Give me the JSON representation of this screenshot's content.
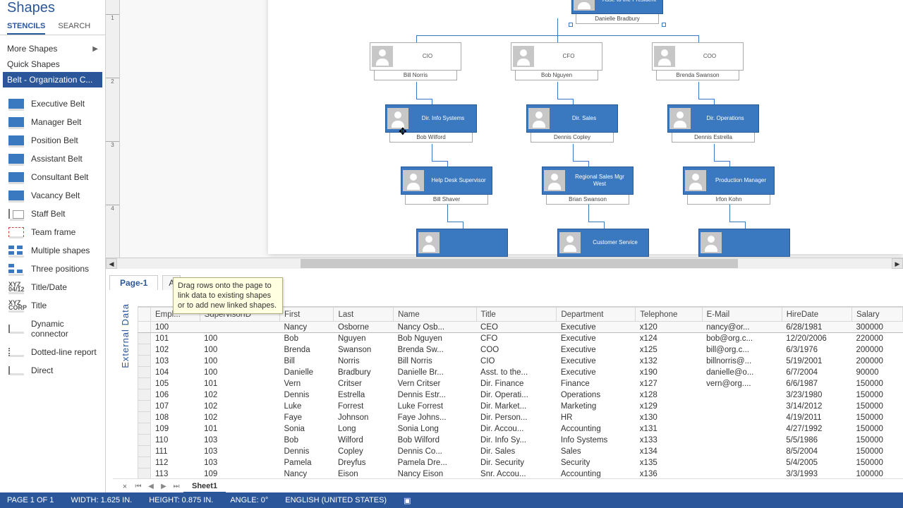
{
  "shapes": {
    "title": "Shapes",
    "tabs": {
      "stencils": "STENCILS",
      "search": "SEARCH"
    },
    "links": {
      "more": "More Shapes",
      "quick": "Quick Shapes",
      "belt": "Belt - Organization C..."
    },
    "stencils": [
      {
        "icon": "belt",
        "label": "Executive Belt"
      },
      {
        "icon": "belt",
        "label": "Manager Belt"
      },
      {
        "icon": "belt",
        "label": "Position Belt"
      },
      {
        "icon": "belt",
        "label": "Assistant Belt"
      },
      {
        "icon": "belt",
        "label": "Consultant Belt"
      },
      {
        "icon": "belt",
        "label": "Vacancy Belt"
      },
      {
        "icon": "staff",
        "label": "Staff Belt"
      },
      {
        "icon": "team",
        "label": "Team frame"
      },
      {
        "icon": "mult",
        "label": "Multiple shapes"
      },
      {
        "icon": "three",
        "label": "Three positions"
      },
      {
        "icon": "text",
        "text": "XYZ\n04/12",
        "label": "Title/Date"
      },
      {
        "icon": "text",
        "text": "XYZ\nCORP",
        "label": "Title"
      },
      {
        "icon": "conn",
        "label": "Dynamic connector"
      },
      {
        "icon": "dot",
        "label": "Dotted-line report"
      },
      {
        "icon": "conn",
        "label": "Direct"
      }
    ]
  },
  "pages": {
    "page1": "Page-1",
    "all": "A"
  },
  "tooltip": "Drag rows onto the page to link data to existing shapes or to add new linked shapes.",
  "external_label": "External Data",
  "org": {
    "asst": {
      "role": "Asst. to the President",
      "name": "Danielle Bradbury"
    },
    "cio": {
      "role": "CIO",
      "name": "Bill Norris"
    },
    "cfo": {
      "role": "CFO",
      "name": "Bob Nguyen"
    },
    "coo": {
      "role": "COO",
      "name": "Brenda Swanson"
    },
    "dinfo": {
      "role": "Dir. Info Systems",
      "name": "Bob Wilford"
    },
    "dsales": {
      "role": "Dir. Sales",
      "name": "Dennis Copley"
    },
    "dops": {
      "role": "Dir. Operations",
      "name": "Dennis Estrella"
    },
    "help": {
      "role": "Help Desk Supervisor",
      "name": "Bill Shaver"
    },
    "rsw": {
      "role": "Regional Sales Mgr West",
      "name": "Brian Swanson"
    },
    "prod": {
      "role": "Production Manager",
      "name": "Irfon Kohn"
    },
    "cust": {
      "role": "Customer Service",
      "name": ""
    }
  },
  "table": {
    "columns": [
      "Empl...",
      "SupervisorID",
      "First",
      "Last",
      "Name",
      "Title",
      "Department",
      "Telephone",
      "E-Mail",
      "HireDate",
      "Salary"
    ],
    "rows": [
      [
        "100",
        "",
        "Nancy",
        "Osborne",
        "Nancy Osb...",
        "CEO",
        "Executive",
        "x120",
        "nancy@or...",
        "6/28/1981",
        "300000"
      ],
      [
        "101",
        "100",
        "Bob",
        "Nguyen",
        "Bob Nguyen",
        "CFO",
        "Executive",
        "x124",
        "bob@org.c...",
        "12/20/2006",
        "220000"
      ],
      [
        "102",
        "100",
        "Brenda",
        "Swanson",
        "Brenda Sw...",
        "COO",
        "Executive",
        "x125",
        "bill@org.c...",
        "6/3/1976",
        "200000"
      ],
      [
        "103",
        "100",
        "Bill",
        "Norris",
        "Bill Norris",
        "CIO",
        "Executive",
        "x132",
        "billnorris@...",
        "5/19/2001",
        "200000"
      ],
      [
        "104",
        "100",
        "Danielle",
        "Bradbury",
        "Danielle Br...",
        "Asst. to the...",
        "Executive",
        "x190",
        "danielle@o...",
        "6/7/2004",
        "90000"
      ],
      [
        "105",
        "101",
        "Vern",
        "Critser",
        "Vern Critser",
        "Dir. Finance",
        "Finance",
        "x127",
        "vern@org....",
        "6/6/1987",
        "150000"
      ],
      [
        "106",
        "102",
        "Dennis",
        "Estrella",
        "Dennis Estr...",
        "Dir. Operati...",
        "Operations",
        "x128",
        "",
        "3/23/1980",
        "150000"
      ],
      [
        "107",
        "102",
        "Luke",
        "Forrest",
        "Luke Forrest",
        "Dir. Market...",
        "Marketing",
        "x129",
        "",
        "3/14/2012",
        "150000"
      ],
      [
        "108",
        "102",
        "Faye",
        "Johnson",
        "Faye Johns...",
        "Dir. Person...",
        "HR",
        "x130",
        "",
        "4/19/2011",
        "150000"
      ],
      [
        "109",
        "101",
        "Sonia",
        "Long",
        "Sonia Long",
        "Dir. Accou...",
        "Accounting",
        "x131",
        "",
        "4/27/1992",
        "150000"
      ],
      [
        "110",
        "103",
        "Bob",
        "Wilford",
        "Bob Wilford",
        "Dir. Info Sy...",
        "Info Systems",
        "x133",
        "",
        "5/5/1986",
        "150000"
      ],
      [
        "111",
        "103",
        "Dennis",
        "Copley",
        "Dennis Co...",
        "Dir. Sales",
        "Sales",
        "x134",
        "",
        "8/5/2004",
        "150000"
      ],
      [
        "112",
        "103",
        "Pamela",
        "Dreyfus",
        "Pamela Dre...",
        "Dir. Security",
        "Security",
        "x135",
        "",
        "5/4/2005",
        "150000"
      ],
      [
        "113",
        "109",
        "Nancy",
        "Eison",
        "Nancy Eison",
        "Snr. Accou...",
        "Accounting",
        "x136",
        "",
        "3/3/1993",
        "100000"
      ]
    ]
  },
  "sheet": {
    "name": "Sheet1",
    "close": "×"
  },
  "status": {
    "page": "PAGE 1 OF 1",
    "width": "WIDTH: 1.625 IN.",
    "height": "HEIGHT: 0.875 IN.",
    "angle": "ANGLE: 0°",
    "lang": "ENGLISH (UNITED STATES)"
  }
}
